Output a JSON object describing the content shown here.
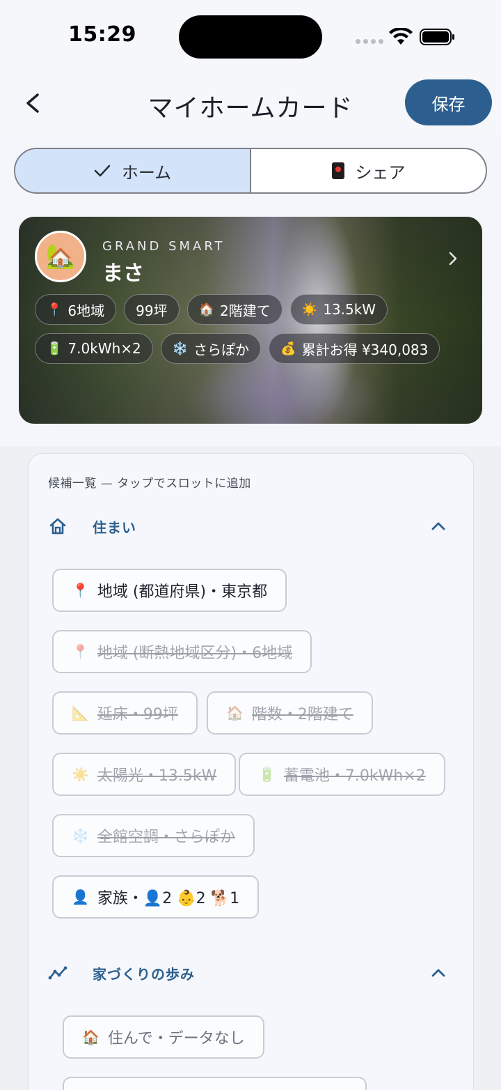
{
  "status_bar": {
    "time": "15:29"
  },
  "header": {
    "title": "マイホームカード",
    "save_label": "保存"
  },
  "tabs": [
    {
      "label": "ホーム",
      "icon": "check-icon",
      "selected": true
    },
    {
      "label": "シェア",
      "icon": "share-card-icon",
      "selected": false
    }
  ],
  "hero": {
    "brand": "GRAND SMART",
    "owner": "まさ",
    "avatar_icon": "🏡",
    "chips": [
      {
        "icon": "📍",
        "label": "6地域"
      },
      {
        "icon": "",
        "label": "99坪"
      },
      {
        "icon": "🏠",
        "label": "2階建て"
      },
      {
        "icon": "☀️",
        "label": "13.5kW"
      },
      {
        "icon": "🔋",
        "label": "7.0kWh×2"
      },
      {
        "icon": "❄️",
        "label": "さらぽか"
      },
      {
        "icon": "💰",
        "label": "累計お得 ¥340,083"
      }
    ]
  },
  "panel": {
    "caption": "候補一覧 — タップでスロットに追加",
    "sections": [
      {
        "title": "住まい",
        "icon": "home-icon",
        "items": [
          {
            "icon": "📍",
            "label": "地域 (都道府県)・東京都",
            "used": false
          },
          {
            "icon": "📍",
            "label": "地域 (断熱地域区分)・6地域",
            "used": true
          },
          {
            "icon": "📐",
            "label": "延床・99坪",
            "used": true
          },
          {
            "icon": "🏠",
            "label": "階数・2階建て",
            "used": true
          },
          {
            "icon": "☀️",
            "label": "太陽光・13.5kW",
            "used": true
          },
          {
            "icon": "🔋",
            "label": "蓄電池・7.0kWh×2",
            "used": true
          },
          {
            "icon": "❄️",
            "label": "全館空調・さらぽか",
            "used": true
          },
          {
            "icon": "👤",
            "label": "家族・👤2 👶2 🐕1",
            "used": false
          }
        ]
      },
      {
        "title": "家づくりの歩み",
        "icon": "trend-line-icon",
        "items": [
          {
            "icon": "🏠",
            "label": "住んで・データなし",
            "used": false
          }
        ]
      }
    ]
  },
  "colors": {
    "accent": "#2c5f8f",
    "tab_active_bg": "#d3e3fa"
  }
}
